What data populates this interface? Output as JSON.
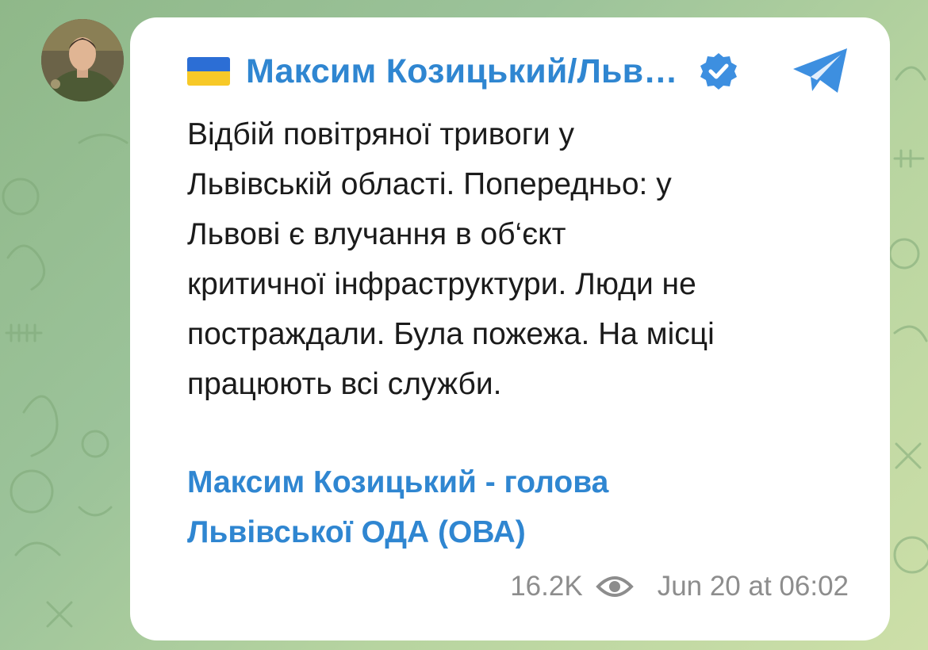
{
  "channel": {
    "flag_icon": "ukraine-flag-icon",
    "name": "Максим Козицький/Льв…",
    "verified_icon": "verified-badge-icon",
    "app_icon": "telegram-icon"
  },
  "message": {
    "text": "Відбій повітряної тривоги у\nЛьвівській області. Попередньо: у\nЛьвові є влучання в об‘єкт\nкритичної інфраструктури. Люди не\nпостраждали. Була пожежа. На місці\nпрацюють всі служби.",
    "signature_link": "Максим Козицький - голова\nЛьвівської ОДА (ОВА)"
  },
  "meta": {
    "views": "16.2K",
    "views_icon": "eye-icon",
    "date": "Jun 20 at 06:02"
  },
  "colors": {
    "accent": "#2f86d1",
    "verified": "#3d8fe0",
    "meta_text": "#8d8d8d",
    "background": "#9cc39a",
    "flag_blue": "#2c6ed5",
    "flag_yellow": "#f7c928"
  }
}
